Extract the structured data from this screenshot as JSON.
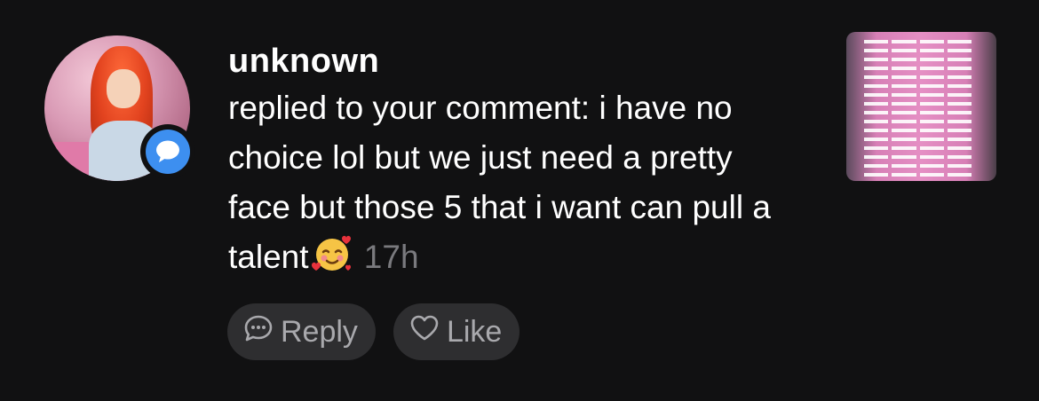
{
  "notification": {
    "username": "unknown",
    "message": "replied to your comment: i have no choice lol but we just need a pretty face but those 5 that i want can pull a talent",
    "emoji": "smiling-face-with-hearts",
    "timestamp": "17h"
  },
  "actions": {
    "reply_label": "Reply",
    "like_label": "Like"
  },
  "icons": {
    "badge": "comment-bubble-icon",
    "reply": "reply-bubble-icon",
    "like": "heart-outline-icon"
  },
  "colors": {
    "background": "#111112",
    "badge_blue": "#3d8ff0",
    "button_bg": "#2e2e30",
    "muted_text": "#7a7a7e"
  }
}
